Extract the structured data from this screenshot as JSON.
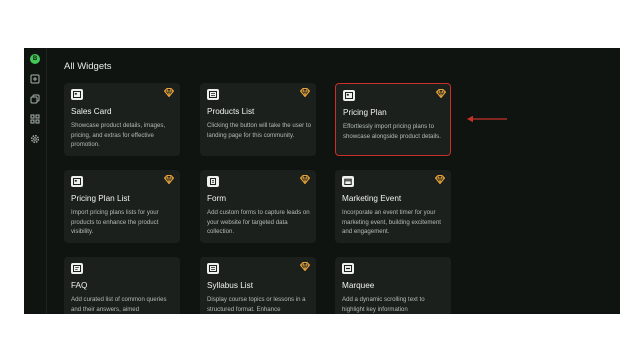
{
  "page": {
    "title": "All Widgets"
  },
  "sidebar": {
    "logo_text": "B",
    "items": [
      "new-page-icon",
      "copy-icon",
      "widgets-grid-icon",
      "settings-gear-icon"
    ]
  },
  "colors": {
    "background": "#0f1410",
    "card": "#1b201c",
    "accent_green": "#43c85a",
    "premium_orange": "#e8a33a",
    "highlight_red": "#c8302a"
  },
  "widgets": [
    {
      "title": "Sales Card",
      "description": "Showcase product details, images, pricing, and extras for effective promotion.",
      "icon": "card-icon",
      "premium": true,
      "selected": false
    },
    {
      "title": "Products List",
      "description": "Clicking the button will take the user to landing page for this community.",
      "icon": "list-icon",
      "premium": true,
      "selected": false
    },
    {
      "title": "Pricing Plan",
      "description": "Effortlessly import pricing plans to showcase alongside product details.",
      "icon": "card-icon",
      "premium": true,
      "selected": true
    },
    {
      "title": "Pricing Plan List",
      "description": "Import pricing plans lists for your products to enhance the product visibility.",
      "icon": "card-icon",
      "premium": true,
      "selected": false
    },
    {
      "title": "Form",
      "description": "Add custom forms to capture leads on your website for targeted data collection.",
      "icon": "form-icon",
      "premium": true,
      "selected": false
    },
    {
      "title": "Marketing Event",
      "description": "Incorporate an event timer for your marketing event, building excitement and engagement.",
      "icon": "calendar-icon",
      "premium": true,
      "selected": false
    },
    {
      "title": "FAQ",
      "description": "Add curated list of common queries and their answers, aimed",
      "icon": "faq-icon",
      "premium": false,
      "selected": false
    },
    {
      "title": "Syllabus List",
      "description": "Display course topics or lessons in a structured format. Enhance",
      "icon": "list-icon",
      "premium": true,
      "selected": false
    },
    {
      "title": "Marquee",
      "description": "Add a dynamic scrolling text to highlight key information",
      "icon": "marquee-icon",
      "premium": false,
      "selected": false
    }
  ]
}
